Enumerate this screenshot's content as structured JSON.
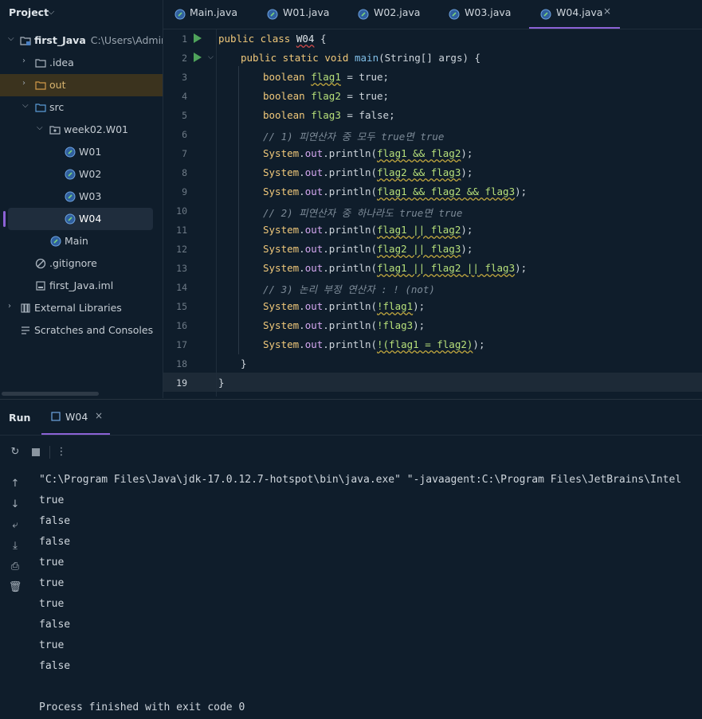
{
  "sidebar": {
    "title": "Project",
    "items": [
      {
        "label": "first_Java",
        "sub": "C:\\Users\\Admin\\I"
      },
      {
        "label": ".idea"
      },
      {
        "label": "out"
      },
      {
        "label": "src"
      },
      {
        "label": "week02.W01"
      },
      {
        "label": "W01"
      },
      {
        "label": "W02"
      },
      {
        "label": "W03"
      },
      {
        "label": "W04"
      },
      {
        "label": "Main"
      },
      {
        "label": ".gitignore"
      },
      {
        "label": "first_Java.iml"
      },
      {
        "label": "External Libraries"
      },
      {
        "label": "Scratches and Consoles"
      }
    ]
  },
  "tabs": [
    {
      "label": "Main.java"
    },
    {
      "label": "W01.java"
    },
    {
      "label": "W02.java"
    },
    {
      "label": "W03.java"
    },
    {
      "label": "W04.java",
      "close": "×"
    }
  ],
  "editor": {
    "line_numbers": [
      "1",
      "2",
      "3",
      "4",
      "5",
      "6",
      "7",
      "8",
      "9",
      "10",
      "11",
      "12",
      "13",
      "14",
      "15",
      "16",
      "17",
      "18",
      "19"
    ],
    "lines": {
      "l1": [
        "public class ",
        "W04",
        " {"
      ],
      "l2": [
        "public static void ",
        "main",
        "(String[] args) {"
      ],
      "l3": [
        "boolean ",
        "flag1",
        " = true;"
      ],
      "l4": [
        "boolean ",
        "flag2",
        " = true;"
      ],
      "l5": [
        "boolean ",
        "flag3",
        " = false;"
      ],
      "l6": "// 1) 피연산자 중 모두 true면 true",
      "l7": [
        "System",
        ".",
        "out",
        ".println(",
        "flag1 && flag2",
        ");"
      ],
      "l8": [
        "System",
        ".",
        "out",
        ".println(",
        "flag2 && flag3",
        ");"
      ],
      "l9": [
        "System",
        ".",
        "out",
        ".println(",
        "flag1 && flag2 && flag3",
        ");"
      ],
      "l10": "// 2) 피연산자 중 하나라도 true면 true",
      "l11": [
        "System",
        ".",
        "out",
        ".println(",
        "flag1 || flag2",
        ");"
      ],
      "l12": [
        "System",
        ".",
        "out",
        ".println(",
        "flag2 || flag3",
        ");"
      ],
      "l13": [
        "System",
        ".",
        "out",
        ".println(",
        "flag1 || flag2 || flag3",
        ");"
      ],
      "l14": "// 3) 논리 부정 연산자 : ! (not)",
      "l15": [
        "System",
        ".",
        "out",
        ".println(",
        "!flag1",
        ");"
      ],
      "l16": [
        "System",
        ".",
        "out",
        ".println(",
        "!flag3",
        ");"
      ],
      "l17": [
        "System",
        ".",
        "out",
        ".println(",
        "!(flag1 = flag2)",
        ");"
      ],
      "l18": "}",
      "l19": "}"
    }
  },
  "run_panel": {
    "label": "Run",
    "tab": "W04",
    "tab_close": "×",
    "command": "\"C:\\Program Files\\Java\\jdk-17.0.12.7-hotspot\\bin\\java.exe\" \"-javaagent:C:\\Program Files\\JetBrains\\Intel",
    "output": [
      "true",
      "false",
      "false",
      "true",
      "true",
      "true",
      "false",
      "true",
      "false"
    ],
    "exit": "Process finished with exit code 0"
  },
  "colors": {
    "accent": "#8c62d6",
    "run": "#4fa35b",
    "keyword": "#f0c87a",
    "variable": "#b7e07a"
  }
}
